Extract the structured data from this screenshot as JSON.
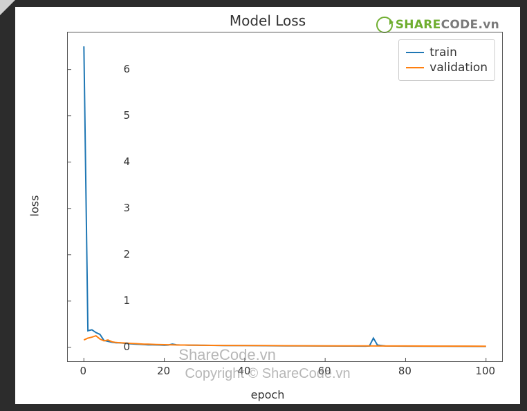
{
  "brand": {
    "icon": "sharecode-logo-icon",
    "text_share": "SHARE",
    "text_code": "CODE",
    "tld": ".vn"
  },
  "watermark1": "ShareCode.vn",
  "watermark2": "Copyright © ShareCode.vn",
  "chart_data": {
    "type": "line",
    "title": "Model Loss",
    "xlabel": "epoch",
    "ylabel": "loss",
    "xlim": [
      -4,
      104
    ],
    "ylim": [
      -0.3,
      6.8
    ],
    "xticks": [
      0,
      20,
      40,
      60,
      80,
      100
    ],
    "yticks": [
      0,
      1,
      2,
      3,
      4,
      5,
      6
    ],
    "legend_position": "upper right",
    "series": [
      {
        "name": "train",
        "color": "#1f77b4",
        "x": [
          0,
          1,
          2,
          3,
          4,
          5,
          6,
          7,
          8,
          9,
          10,
          11,
          12,
          13,
          14,
          15,
          16,
          17,
          18,
          19,
          20,
          21,
          22,
          23,
          24,
          25,
          26,
          27,
          28,
          29,
          30,
          35,
          40,
          45,
          50,
          55,
          60,
          65,
          70,
          71,
          72,
          73,
          74,
          75,
          80,
          85,
          90,
          95,
          100
        ],
        "values": [
          6.5,
          0.36,
          0.38,
          0.32,
          0.28,
          0.15,
          0.13,
          0.11,
          0.1,
          0.1,
          0.09,
          0.08,
          0.075,
          0.07,
          0.065,
          0.06,
          0.055,
          0.055,
          0.052,
          0.05,
          0.048,
          0.05,
          0.07,
          0.055,
          0.05,
          0.05,
          0.048,
          0.047,
          0.046,
          0.045,
          0.045,
          0.04,
          0.038,
          0.035,
          0.033,
          0.032,
          0.03,
          0.028,
          0.027,
          0.03,
          0.2,
          0.05,
          0.04,
          0.03,
          0.027,
          0.025,
          0.023,
          0.022,
          0.02
        ]
      },
      {
        "name": "validation",
        "color": "#ff7f0e",
        "x": [
          0,
          1,
          2,
          3,
          4,
          5,
          6,
          7,
          8,
          9,
          10,
          11,
          12,
          13,
          14,
          15,
          16,
          17,
          18,
          19,
          20,
          21,
          22,
          23,
          24,
          25,
          30,
          35,
          40,
          45,
          50,
          55,
          60,
          65,
          70,
          75,
          80,
          85,
          90,
          95,
          100
        ],
        "values": [
          0.16,
          0.2,
          0.22,
          0.25,
          0.18,
          0.14,
          0.16,
          0.12,
          0.105,
          0.1,
          0.095,
          0.09,
          0.085,
          0.08,
          0.075,
          0.07,
          0.068,
          0.065,
          0.062,
          0.06,
          0.058,
          0.056,
          0.054,
          0.052,
          0.05,
          0.05,
          0.045,
          0.042,
          0.04,
          0.038,
          0.036,
          0.034,
          0.033,
          0.032,
          0.031,
          0.03,
          0.029,
          0.028,
          0.027,
          0.026,
          0.025
        ]
      }
    ]
  }
}
